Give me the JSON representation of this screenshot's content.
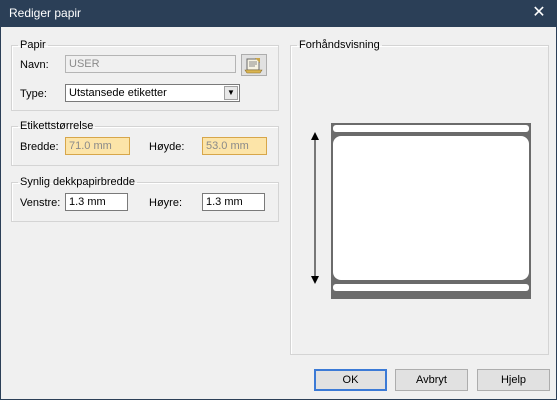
{
  "window": {
    "title": "Rediger papir",
    "close_glyph": "✕"
  },
  "paper": {
    "legend": "Papir",
    "name_label": "Navn:",
    "name_value": "USER",
    "type_label": "Type:",
    "type_value": "Utstansede etiketter",
    "browse_icon": "folder-open-icon"
  },
  "label_size": {
    "legend": "Etikettstørrelse",
    "width_label": "Bredde:",
    "width_value": "71.0 mm",
    "height_label": "Høyde:",
    "height_value": "53.0 mm"
  },
  "backing": {
    "legend": "Synlig dekkpapirbredde",
    "left_label": "Venstre:",
    "left_value": "1.3 mm",
    "right_label": "Høyre:",
    "right_value": "1.3 mm"
  },
  "preview": {
    "legend": "Forhåndsvisning"
  },
  "buttons": {
    "ok": "OK",
    "cancel": "Avbryt",
    "help": "Hjelp"
  },
  "colors": {
    "titlebar": "#2b3f57",
    "highlight_field": "#fce4a8",
    "preview_backing": "#6b6b6b"
  }
}
